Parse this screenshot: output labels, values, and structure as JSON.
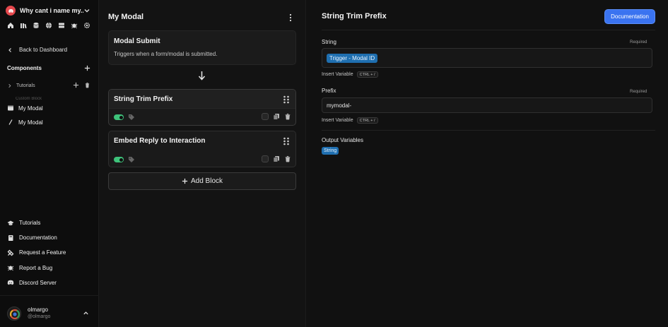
{
  "sidebar": {
    "server_name": "Why cant i name my...",
    "back_label": "Back to Dashboard",
    "components_label": "Components",
    "tutorials_folder": "Tutorials",
    "ghost_row": "Custom Block",
    "items": [
      {
        "label": "My Modal",
        "icon": "modal-icon"
      },
      {
        "label": "My Modal",
        "icon": "slash-command-icon"
      }
    ],
    "bottom_nav": [
      {
        "label": "Tutorials",
        "icon": "graduation-cap-icon"
      },
      {
        "label": "Documentation",
        "icon": "book-icon"
      },
      {
        "label": "Request a Feature",
        "icon": "tools-icon"
      },
      {
        "label": "Report a Bug",
        "icon": "bug-icon"
      },
      {
        "label": "Discord Server",
        "icon": "discord-icon"
      }
    ],
    "user": {
      "name": "olmargo",
      "handle": "@olmargo"
    }
  },
  "middle": {
    "title": "My Modal",
    "trigger": {
      "title": "Modal Submit",
      "description": "Triggers when a form/modal is submitted."
    },
    "blocks": [
      {
        "title": "String Trim Prefix",
        "enabled": true
      },
      {
        "title": "Embed Reply to Interaction",
        "enabled": true
      }
    ],
    "add_block_label": "Add Block"
  },
  "panel": {
    "title": "String Trim Prefix",
    "doc_button": "Documentation",
    "required_label": "Required",
    "string_field": {
      "label": "String",
      "value": "Trigger - Modal ID"
    },
    "prefix_field": {
      "label": "Prefix",
      "value": "mymodal-"
    },
    "insert_variable": "Insert Variable",
    "shortcut": "CTRL + /",
    "output_label": "Output Variables",
    "output_value": "String"
  },
  "colors": {
    "accent": "#3a73f0",
    "toggle_on": "#3ec27a",
    "variable_pill": "#1f6fb0",
    "server_logo": "#e5484d"
  }
}
